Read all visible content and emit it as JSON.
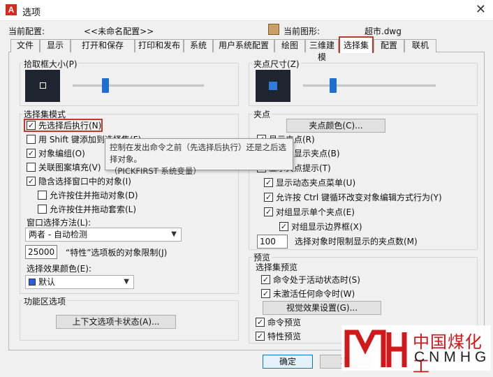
{
  "window": {
    "title": "选项",
    "app_icon_letter": "A"
  },
  "profile": {
    "current_config_label": "当前配置:",
    "current_config_value": "<<未命名配置>>",
    "current_drawing_label": "当前图形:",
    "current_drawing_value": "超市.dwg"
  },
  "tabs": [
    "文件",
    "显示",
    "打开和保存",
    "打印和发布",
    "系统",
    "用户系统配置",
    "绘图",
    "三维建模",
    "选择集",
    "配置",
    "联机"
  ],
  "active_tab": "选择集",
  "pickbox": {
    "title": "拾取框大小(P)"
  },
  "selection_modes": {
    "title": "选择集模式",
    "items": [
      {
        "label": "先选择后执行(N)",
        "checked": true
      },
      {
        "label": "用 Shift 键添加到选择集(F)",
        "checked": false
      },
      {
        "label": "对象编组(O)",
        "checked": true
      },
      {
        "label": "关联图案填充(V)",
        "checked": false
      },
      {
        "label": "隐含选择窗口中的对象(I)",
        "checked": true
      },
      {
        "label": "允许按住并拖动对象(D)",
        "checked": false
      },
      {
        "label": "允许按住并拖动套索(L)",
        "checked": false
      }
    ],
    "window_method_label": "窗口选择方法(L):",
    "window_method_value": "两者 - 自动检测",
    "limit_value": "25000",
    "limit_label": "“特性”选项板的对象限制(J)",
    "effect_color_label": "选择效果颜色(E):",
    "effect_color_value": "默认"
  },
  "tooltip": {
    "line1": "控制在发出命令之前（先选择后执行）还是之后选择对象。",
    "line2": "（PICKFIRST 系统变量）"
  },
  "ribbon": {
    "title": "功能区选项",
    "button": "上下文选项卡状态(A)..."
  },
  "gripsize": {
    "title": "夹点尺寸(Z)"
  },
  "grips": {
    "title": "夹点",
    "color_button": "夹点颜色(C)...",
    "items": [
      {
        "label": "显示夹点(R)",
        "checked": true
      },
      {
        "label": "在块中显示夹点(B)",
        "checked": false
      },
      {
        "label": "显示夹点提示(T)",
        "checked": true
      },
      {
        "label": "显示动态夹点菜单(U)",
        "checked": true
      },
      {
        "label": "允许按 Ctrl 键循环改变对象编辑方式行为(Y)",
        "checked": true
      },
      {
        "label": "对组显示单个夹点(E)",
        "checked": true
      },
      {
        "label": "对组显示边界框(X)",
        "checked": true
      }
    ],
    "limit_value": "100",
    "limit_label": "选择对象时限制显示的夹点数(M)"
  },
  "preview": {
    "title": "预览",
    "subtitle": "选择集预览",
    "items": [
      {
        "label": "命令处于活动状态时(S)",
        "checked": true
      },
      {
        "label": "未激活任何命令时(W)",
        "checked": true
      }
    ],
    "visual_button": "视觉效果设置(G)...",
    "command_preview": {
      "label": "命令预览",
      "checked": true
    },
    "property_preview": {
      "label": "特性预览",
      "checked": true
    }
  },
  "buttons": {
    "ok": "确定",
    "cancel": "取"
  },
  "watermark": {
    "cn": "中国煤化工",
    "en": "CNMHG"
  },
  "colors": {
    "accent_red": "#c0392b",
    "grip_blue": "#2d7ae0",
    "thumb_blue": "#1f6fd1"
  }
}
